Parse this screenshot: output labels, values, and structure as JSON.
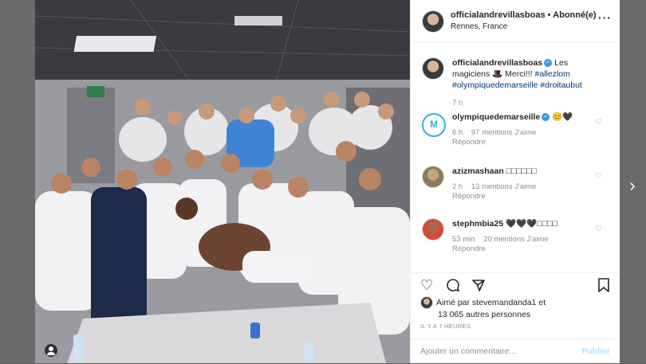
{
  "post": {
    "username": "officialandrevillasboas",
    "follow_status": "Abonné(e)",
    "location": "Rennes, France",
    "more_icon": "more-horizontal-icon"
  },
  "caption": {
    "username": "officialandrevillasboas",
    "text": "Les magiciens 🎩 Merci!!!",
    "hashtags": "#allezlom #olympiquedemarseille #droitaubut",
    "time": "7 h"
  },
  "comments": [
    {
      "username": "olympiquedemarseille",
      "verified": true,
      "text": "😊🖤",
      "time": "6 h",
      "likes": "97 mentions J'aime",
      "reply": "Répondre"
    },
    {
      "username": "azizmashaan",
      "verified": false,
      "text": "□□□□□□",
      "time": "2 h",
      "likes": "13 mentions J'aime",
      "reply": "Répondre"
    },
    {
      "username": "stephmbia25",
      "verified": false,
      "text": "🖤🖤🖤□□□□",
      "time": "53 min",
      "likes": "20 mentions J'aime",
      "reply": "Répondre"
    }
  ],
  "actions": {
    "like_icon": "heart-icon",
    "comment_icon": "comment-icon",
    "share_icon": "share-icon",
    "save_icon": "bookmark-icon"
  },
  "likes": {
    "line1": "Aimé par stevemandanda1 et",
    "line2": "13 065 autres personnes"
  },
  "timestamp": "IL Y A 7 HEURES",
  "add_comment": {
    "placeholder": "Ajouter un commentaire...",
    "publish_label": "Publier"
  },
  "colors": {
    "accent_blue": "#3897f0",
    "om_blue": "#2faee0",
    "muted": "#8e8e8e"
  }
}
